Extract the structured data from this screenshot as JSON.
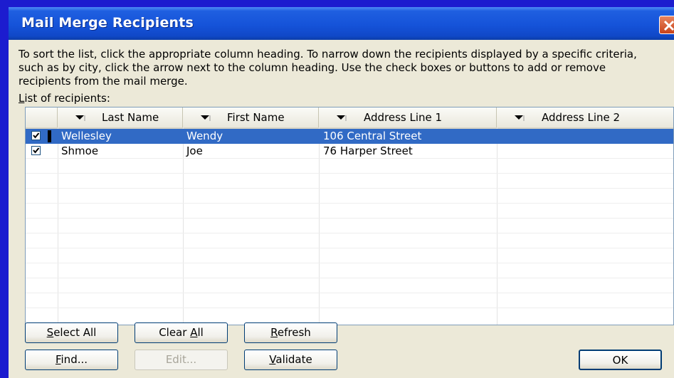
{
  "window": {
    "title": "Mail Merge Recipients"
  },
  "instructions": "To sort the list, click the appropriate column heading.  To narrow down the recipients displayed by a specific criteria, such as by city, click the arrow next to the column heading.  Use the check boxes or buttons to add or remove recipients from the mail merge.",
  "list_label": {
    "first_letter": "L",
    "rest": "ist of recipients:"
  },
  "table": {
    "columns": [
      "Last Name",
      "First Name",
      "Address Line 1",
      "Address Line 2"
    ],
    "rows": [
      {
        "checked": true,
        "selected": true,
        "last_name": "Wellesley",
        "first_name": "Wendy",
        "address1": "106 Central Street",
        "address2": ""
      },
      {
        "checked": true,
        "selected": false,
        "last_name": "Shmoe",
        "first_name": "Joe",
        "address1": "76 Harper Street",
        "address2": ""
      }
    ]
  },
  "buttons": {
    "select_all": {
      "u": "S",
      "rest": "elect All"
    },
    "clear_all": {
      "pre": "Clear ",
      "u": "A",
      "rest": "ll"
    },
    "refresh": {
      "u": "R",
      "rest": "efresh"
    },
    "find": {
      "u": "F",
      "rest": "ind..."
    },
    "edit": "Edit...",
    "validate": {
      "u": "V",
      "rest": "alidate"
    },
    "ok": "OK"
  },
  "colors": {
    "selection": "#316ac5",
    "titlebar": "#1553d9",
    "dialog_bg": "#ece9d8"
  }
}
